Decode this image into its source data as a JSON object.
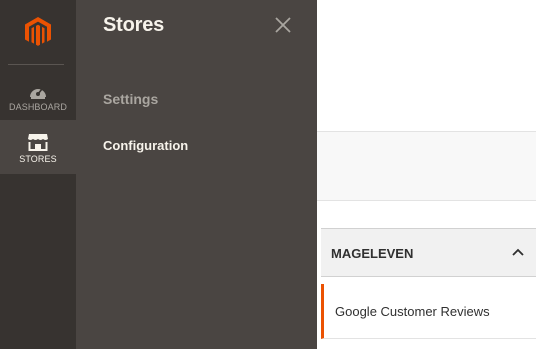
{
  "nav": {
    "items": [
      {
        "label": "DASHBOARD",
        "icon": "speedometer-icon"
      },
      {
        "label": "STORES",
        "icon": "storefront-icon"
      }
    ],
    "logo": "magento-logo",
    "active_color": "#eb5202"
  },
  "panel": {
    "title": "Stores",
    "section_heading": "Settings",
    "links": [
      "Configuration"
    ]
  },
  "content": {
    "accordion": {
      "title": "MAGELEVEN",
      "items": [
        "Google Customer Reviews"
      ]
    }
  }
}
